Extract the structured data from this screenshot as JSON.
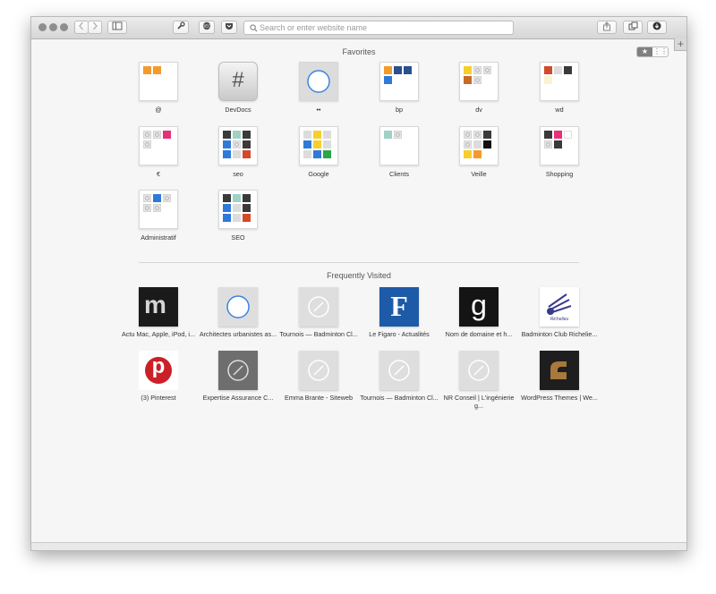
{
  "toolbar": {
    "address_placeholder": "Search or enter website name",
    "back_icon": "chevron-left-icon",
    "forward_icon": "chevron-right-icon",
    "sidebar_icon": "sidebar-icon",
    "tools_icon": "wrench-icon",
    "extension_icon": "extension-badge-icon",
    "pocket_icon": "pocket-icon",
    "share_icon": "share-icon",
    "tabs_icon": "tabs-overview-icon",
    "downloads_icon": "download-icon",
    "new_tab_label": "+"
  },
  "favorites": {
    "title": "Favorites",
    "items": [
      {
        "label": "@"
      },
      {
        "label": "DevDocs"
      },
      {
        "label": "••"
      },
      {
        "label": "bp"
      },
      {
        "label": "dv"
      },
      {
        "label": "wd"
      },
      {
        "label": "€"
      },
      {
        "label": "seo"
      },
      {
        "label": "Google"
      },
      {
        "label": "Clients"
      },
      {
        "label": "Veille"
      },
      {
        "label": "Shopping"
      },
      {
        "label": "Administratif"
      },
      {
        "label": "SEO"
      }
    ],
    "devdocs_glyph": "#"
  },
  "frequently_visited": {
    "title": "Frequently Visited",
    "items": [
      {
        "label": "Actu Mac, Apple, iPod, i..."
      },
      {
        "label": "Architectes urbanistes as..."
      },
      {
        "label": "Tournois — Badminton Cl..."
      },
      {
        "label": "Le Figaro - Actualités"
      },
      {
        "label": "Nom de domaine et h..."
      },
      {
        "label": "Badminton Club Richelie..."
      },
      {
        "label": "(3) Pinterest"
      },
      {
        "label": "Expertise Assurance C..."
      },
      {
        "label": "Emma Brante - Siteweb"
      },
      {
        "label": "Tournois — Badminton Cl..."
      },
      {
        "label": "NR Conseil | L'ingénierie g..."
      },
      {
        "label": "WordPress Themes | We..."
      }
    ],
    "glyphs": {
      "macg": "m",
      "figaro": "F",
      "gandi": "g",
      "pinterest": "p",
      "richelieu": "Richelieu"
    }
  },
  "view_toggle": {
    "star": "★",
    "grid": "⋮⋮"
  }
}
